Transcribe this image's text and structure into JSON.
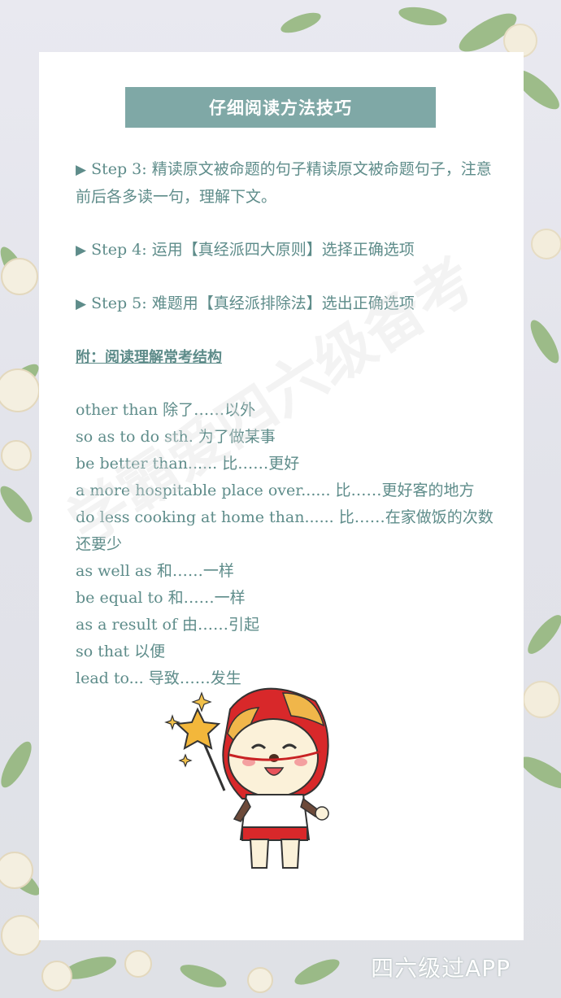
{
  "title": "仔细阅读方法技巧",
  "steps": [
    {
      "label": "Step 3:",
      "text": "精读原文被命题的句子精读原文被命题句子，注意前后各多读一句，理解下文。"
    },
    {
      "label": "Step 4:",
      "text": "运用【真经派四大原则】选择正确选项"
    },
    {
      "label": "Step 5:",
      "text": "难题用【真经派排除法】选出正确选项"
    }
  ],
  "appendix_heading": "附：阅读理解常考结构",
  "phrases": [
    "other than 除了……以外",
    "so as to do sth. 为了做某事",
    "be better than...... 比……更好",
    "a more hospitable place over...... 比……更好客的地方",
    "do less cooking at home than...... 比……在家做饭的次数还要少",
    "as well as 和……一样",
    "be equal to 和……一样",
    "as a result of 由……引起",
    "so that 以便",
    "lead to... 导致……发生"
  ],
  "watermark": "学霸爱四六级备考",
  "footer_brand": "四六级过APP",
  "colors": {
    "accent": "#7fa8a6",
    "text": "#5e8c8a",
    "card": "#ffffff"
  },
  "icons": {
    "bullet": "play-triangle-icon",
    "mascot": "lion-mascot-with-star-wand"
  }
}
